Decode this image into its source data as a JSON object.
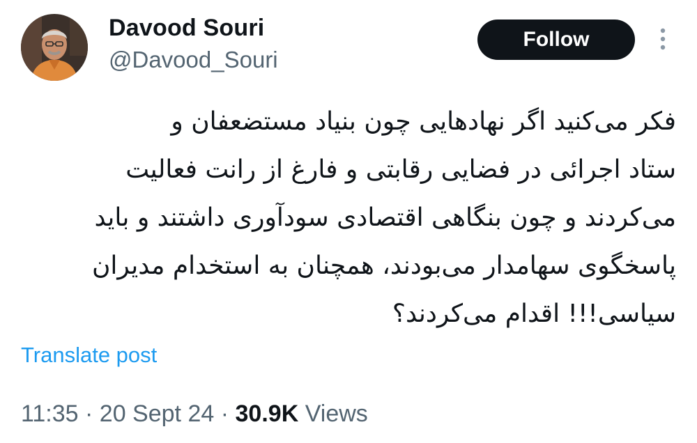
{
  "author": {
    "display_name": "Davood Souri",
    "handle": "@Davood_Souri",
    "avatar_icon": "person-photo-avatar"
  },
  "actions": {
    "follow_label": "Follow",
    "more_icon": "vertical-ellipsis-icon"
  },
  "post": {
    "lines": [
      "فکر می‌کنید اگر نهادهایی چون بنیاد مستضعفان و",
      "ستاد اجرائی در فضایی رقابتی و فارغ از رانت فعالیت",
      "می‌کردند و چون بنگاهی اقتصادی سودآوری داشتند و باید",
      "پاسخگوی سهامدار می‌بودند، همچنان به استخدام مدیران",
      "سیاسی!!! اقدام می‌کردند؟"
    ],
    "translate_label": "Translate post"
  },
  "meta": {
    "time": "11:35",
    "separator": "·",
    "date": "20 Sept 24",
    "views_count": "30.9K",
    "views_label": "Views"
  },
  "colors": {
    "text_primary": "#0f1419",
    "text_secondary": "#536471",
    "link": "#1d9bf0",
    "follow_bg": "#0f1419",
    "follow_text": "#ffffff"
  }
}
